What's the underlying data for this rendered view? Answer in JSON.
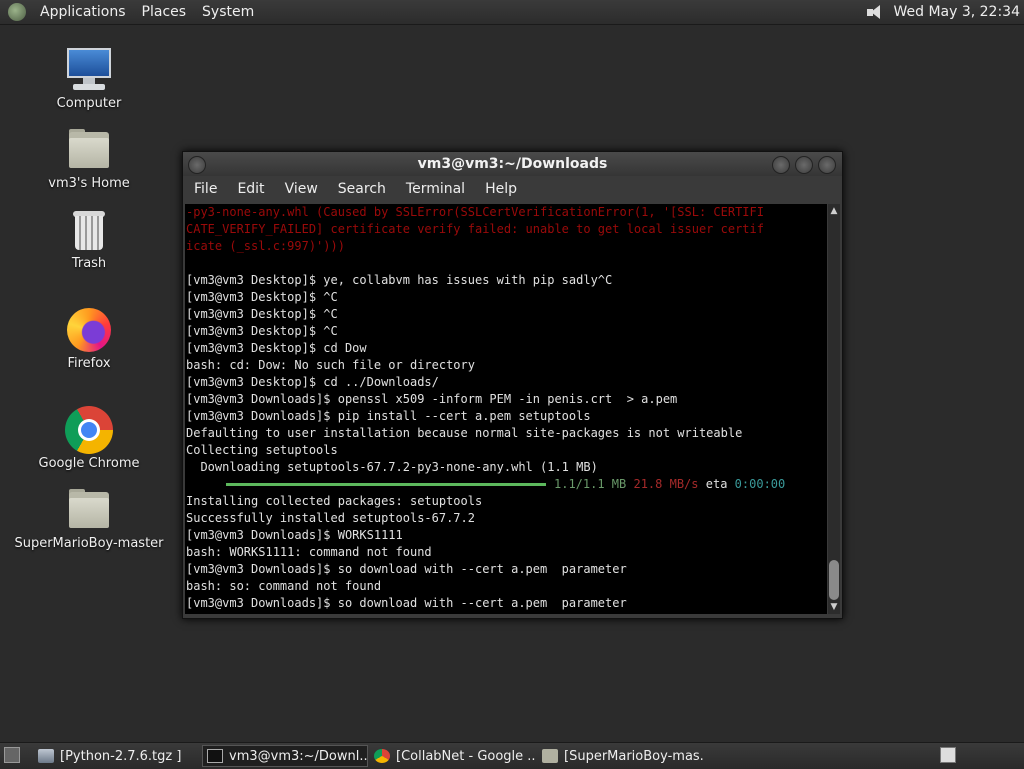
{
  "top_panel": {
    "menus": [
      "Applications",
      "Places",
      "System"
    ],
    "clock": "Wed May  3, 22:34"
  },
  "desktop_icons": [
    {
      "label": "Computer",
      "icon": "computer-icon"
    },
    {
      "label": "vm3's Home",
      "icon": "home-folder-icon"
    },
    {
      "label": "Trash",
      "icon": "trash-icon"
    },
    {
      "label": "Firefox",
      "icon": "firefox-icon"
    },
    {
      "label": "Google Chrome",
      "icon": "chrome-icon"
    },
    {
      "label": "SuperMarioBoy-master",
      "icon": "folder-icon"
    }
  ],
  "terminal": {
    "title": "vm3@vm3:~/Downloads",
    "menu": [
      "File",
      "Edit",
      "View",
      "Search",
      "Terminal",
      "Help"
    ],
    "error_lines": [
      "-py3-none-any.whl (Caused by SSLError(SSLCertVerificationError(1, '[SSL: CERTIFI",
      "CATE_VERIFY_FAILED] certificate verify failed: unable to get local issuer certif",
      "icate (_ssl.c:997)')))"
    ],
    "lines_before_progress": [
      "",
      "[vm3@vm3 Desktop]$ ye, collabvm has issues with pip sadly^C",
      "[vm3@vm3 Desktop]$ ^C",
      "[vm3@vm3 Desktop]$ ^C",
      "[vm3@vm3 Desktop]$ ^C",
      "[vm3@vm3 Desktop]$ cd Dow",
      "bash: cd: Dow: No such file or directory",
      "[vm3@vm3 Desktop]$ cd ../Downloads/",
      "[vm3@vm3 Downloads]$ openssl x509 -inform PEM -in penis.crt  > a.pem",
      "[vm3@vm3 Downloads]$ pip install --cert a.pem setuptools",
      "Defaulting to user installation because normal site-packages is not writeable",
      "Collecting setuptools",
      "  Downloading setuptools-67.7.2-py3-none-any.whl (1.1 MB)"
    ],
    "progress": {
      "fraction": 1.0,
      "size": "1.1/1.1 MB",
      "speed": "21.8 MB/s",
      "eta_label": "eta",
      "eta": "0:00:00"
    },
    "lines_after_progress": [
      "Installing collected packages: setuptools",
      "Successfully installed setuptools-67.7.2",
      "[vm3@vm3 Downloads]$ WORKS1111",
      "bash: WORKS1111: command not found",
      "[vm3@vm3 Downloads]$ so download with --cert a.pem  parameter",
      "bash: so: command not found",
      "[vm3@vm3 Downloads]$ so download with --cert a.pem  parameter"
    ]
  },
  "taskbar": {
    "items": [
      {
        "label": "[Python-2.7.6.tgz ]",
        "icon": "package-icon",
        "active": false
      },
      {
        "label": "vm3@vm3:~/Downl...",
        "icon": "terminal-icon",
        "active": true
      },
      {
        "label": "[CollabNet - Google ...",
        "icon": "chrome-icon",
        "active": false
      },
      {
        "label": "[SuperMarioBoy-mas...",
        "icon": "folder-icon",
        "active": false
      }
    ]
  },
  "colors": {
    "desktop_bg": "#2b2b2b",
    "terminal_bg": "#000000",
    "error_text": "#9b0a0a",
    "progress_bar": "#5cb85c"
  }
}
